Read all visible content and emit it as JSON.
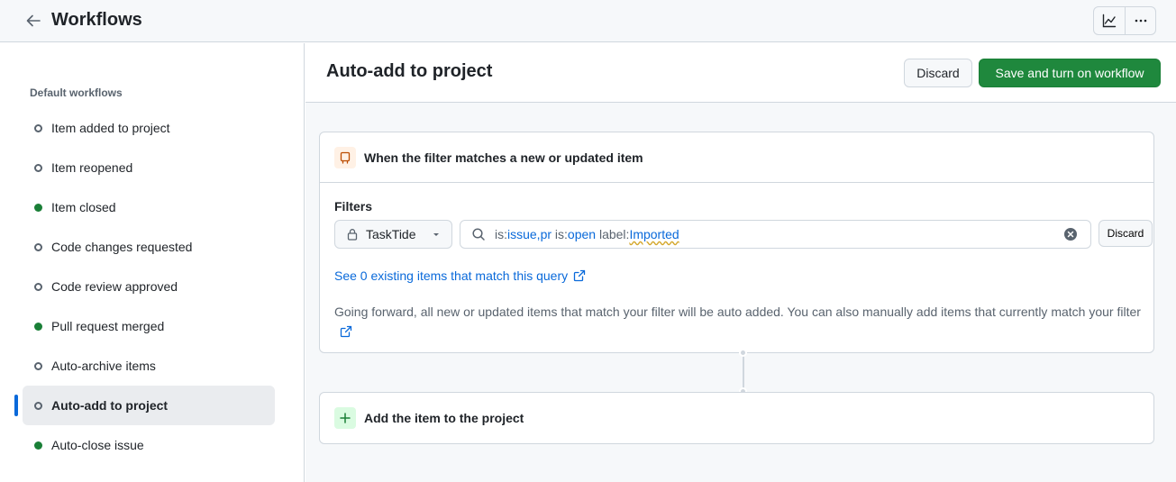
{
  "header": {
    "title": "Workflows"
  },
  "sidebar": {
    "heading": "Default workflows",
    "items": [
      {
        "label": "Item added to project",
        "enabled": false,
        "active": false
      },
      {
        "label": "Item reopened",
        "enabled": false,
        "active": false
      },
      {
        "label": "Item closed",
        "enabled": true,
        "active": false
      },
      {
        "label": "Code changes requested",
        "enabled": false,
        "active": false
      },
      {
        "label": "Code review approved",
        "enabled": false,
        "active": false
      },
      {
        "label": "Pull request merged",
        "enabled": true,
        "active": false
      },
      {
        "label": "Auto-archive items",
        "enabled": false,
        "active": false
      },
      {
        "label": "Auto-add to project",
        "enabled": false,
        "active": true
      },
      {
        "label": "Auto-close issue",
        "enabled": true,
        "active": false
      }
    ]
  },
  "main": {
    "title": "Auto-add to project",
    "discard_label": "Discard",
    "save_label": "Save and turn on workflow",
    "trigger": {
      "title": "When the filter matches a new or updated item",
      "filters_label": "Filters",
      "repository": "TaskTide",
      "query": {
        "t1k": "is:",
        "t1v": "issue,pr",
        "t2k": " is:",
        "t2v": "open",
        "t3k": " label:",
        "t3v": "Imported"
      },
      "discard_label": "Discard",
      "match_link": "See 0 existing items that match this query",
      "description": "Going forward, all new or updated items that match your filter will be auto added. You can also manually add items that currently match your filter"
    },
    "action": {
      "title": "Add the item to the project"
    }
  },
  "colors": {
    "accent": "#0969da",
    "success": "#1f883d",
    "enabled_dot": "#1a7f37"
  }
}
